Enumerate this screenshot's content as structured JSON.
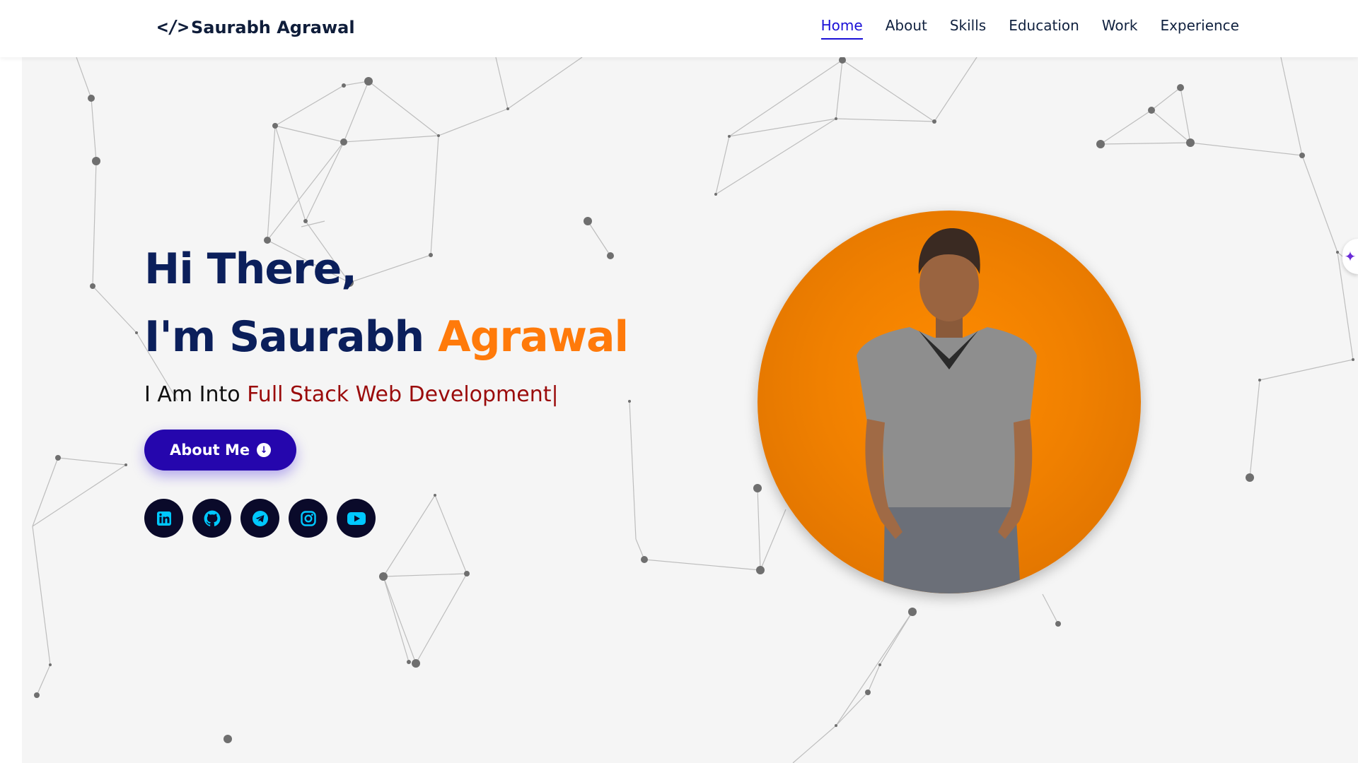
{
  "header": {
    "logo_icon": "</>",
    "logo_text": "Saurabh Agrawal",
    "nav": [
      {
        "label": "Home",
        "active": true
      },
      {
        "label": "About",
        "active": false
      },
      {
        "label": "Skills",
        "active": false
      },
      {
        "label": "Education",
        "active": false
      },
      {
        "label": "Work",
        "active": false
      },
      {
        "label": "Experience",
        "active": false
      }
    ]
  },
  "hero": {
    "greeting_line1": "Hi There,",
    "greeting_line2_prefix": "I'm Saurabh ",
    "greeting_line2_accent": "Agrawal",
    "tagline_prefix": "I Am Into ",
    "tagline_typed": "Full Stack Web Development|",
    "button_label": "About Me",
    "button_icon": "arrow-down-circle-icon",
    "socials": [
      {
        "name": "linkedin-icon"
      },
      {
        "name": "github-icon"
      },
      {
        "name": "telegram-icon"
      },
      {
        "name": "instagram-icon"
      },
      {
        "name": "youtube-icon"
      }
    ]
  },
  "colors": {
    "nav_active": "#1a10d6",
    "heading": "#0b1f5b",
    "accent_orange": "#ff7a0a",
    "typed_text": "#9a0b0b",
    "button_bg": "#2506ad",
    "social_bg": "#0a0a2a",
    "social_icon": "#00c8ff",
    "avatar_bg": "#ff8c00",
    "hero_bg": "#f5f5f5"
  }
}
